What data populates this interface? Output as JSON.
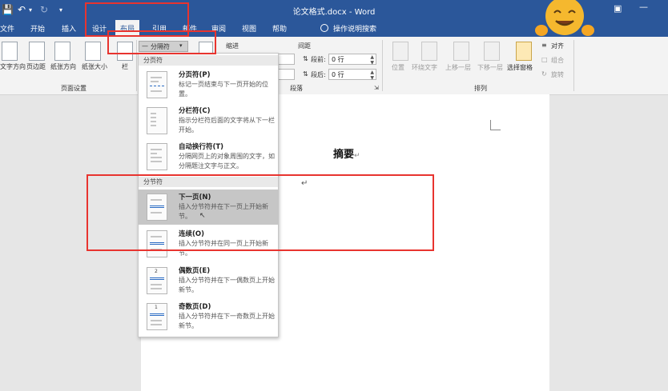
{
  "window": {
    "title": "论文格式.docx - Word",
    "qat": {
      "save_icon": "save-icon",
      "undo_icon": "undo-icon",
      "redo_icon": "redo-icon",
      "customize_icon": "customize-qat-icon"
    }
  },
  "tabs": [
    {
      "label": "文件"
    },
    {
      "label": "开始"
    },
    {
      "label": "插入"
    },
    {
      "label": "设计"
    },
    {
      "label": "布局"
    },
    {
      "label": "引用"
    },
    {
      "label": "邮件"
    },
    {
      "label": "审阅"
    },
    {
      "label": "视图"
    },
    {
      "label": "帮助"
    }
  ],
  "tell_me": "操作说明搜索",
  "ribbon": {
    "page_setup": {
      "buttons": [
        {
          "label": "文字方向"
        },
        {
          "label": "页边距"
        },
        {
          "label": "纸张方向"
        },
        {
          "label": "纸张大小"
        },
        {
          "label": "栏"
        }
      ],
      "breaks_button": "分隔符",
      "group_label": "页面设置"
    },
    "indent": {
      "label": "缩进"
    },
    "spacing": {
      "label": "间距",
      "before_label": "段前:",
      "before_value": "0 行",
      "after_label": "段后:",
      "after_value": "0 行"
    },
    "paragraph_group_label": "段落",
    "arrange": {
      "buttons": [
        {
          "label": "位置"
        },
        {
          "label": "环绕文字"
        },
        {
          "label": "上移一层"
        },
        {
          "label": "下移一层"
        },
        {
          "label": "选择窗格"
        }
      ],
      "align": "对齐",
      "group": "组合",
      "rotate": "旋转",
      "group_label": "排列"
    }
  },
  "dropdown": {
    "page_breaks_header": "分页符",
    "section_breaks_header": "分节符",
    "items": [
      {
        "title": "分页符(P)",
        "desc": "标记一页结束与下一页开始的位置。"
      },
      {
        "title": "分栏符(C)",
        "desc": "指示分栏符后面的文字将从下一栏开始。"
      },
      {
        "title": "自动换行符(T)",
        "desc": "分隔网页上的对象周围的文字，如分隔题注文字与正文。"
      },
      {
        "title": "下一页(N)",
        "desc": "插入分节符并在下一页上开始新节。"
      },
      {
        "title": "连续(O)",
        "desc": "插入分节符并在同一页上开始新节。"
      },
      {
        "title": "偶数页(E)",
        "desc": "插入分节符并在下一偶数页上开始新节。"
      },
      {
        "title": "奇数页(D)",
        "desc": "插入分节符并在下一奇数页上开始新节。"
      }
    ]
  },
  "document": {
    "heading": "摘要"
  },
  "colors": {
    "word_blue": "#2b579a",
    "highlight_red": "#e8342f",
    "hover_gray": "#c6c6c6"
  }
}
